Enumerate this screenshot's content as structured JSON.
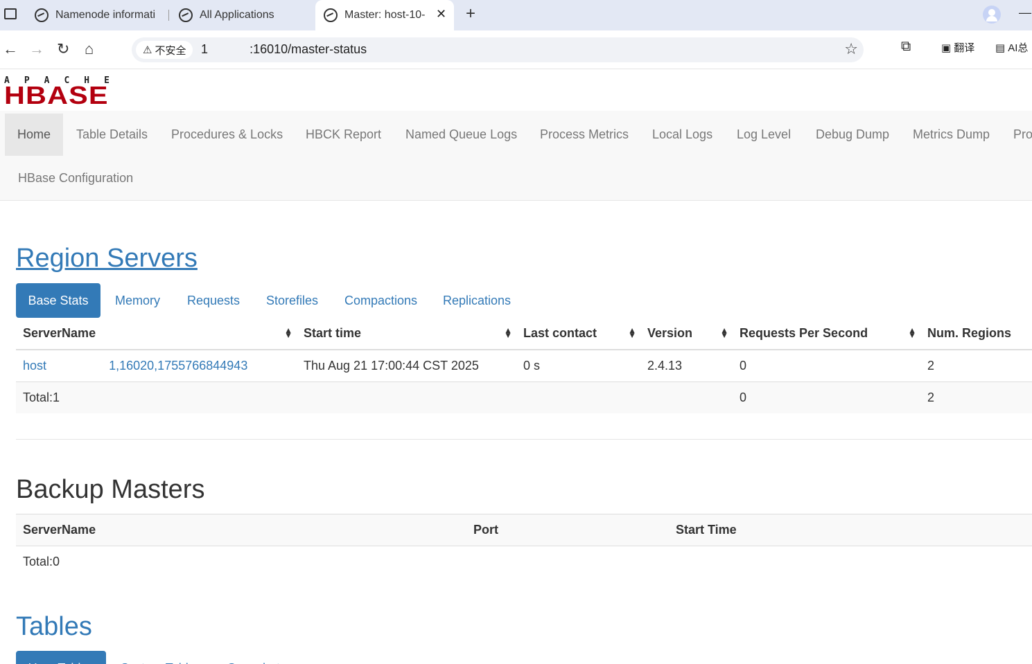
{
  "browser": {
    "tabs": [
      {
        "title": "Namenode informati"
      },
      {
        "title": "All Applications"
      },
      {
        "title": "Master: host-10-"
      }
    ],
    "security_label": "不安全",
    "url": "1      :16010/master-status",
    "translate_label": "翻译",
    "ai_label": "AI总"
  },
  "nav": {
    "items": [
      "Home",
      "Table Details",
      "Procedures & Locks",
      "HBCK Report",
      "Named Queue Logs",
      "Process Metrics",
      "Local Logs",
      "Log Level",
      "Debug Dump",
      "Metrics Dump",
      "Pro"
    ],
    "config": "HBase Configuration"
  },
  "logo": {
    "top": "APACHE",
    "bottom": "HBASE"
  },
  "region_servers": {
    "title": "Region Servers",
    "tabs": [
      "Base Stats",
      "Memory",
      "Requests",
      "Storefiles",
      "Compactions",
      "Replications"
    ],
    "columns": [
      "ServerName",
      "Start time",
      "Last contact",
      "Version",
      "Requests Per Second",
      "Num. Regions"
    ],
    "rows": [
      {
        "server": "host         1,16020,1755766844943",
        "start": "Thu Aug 21 17:00:44 CST 2025",
        "contact": "0 s",
        "version": "2.4.13",
        "rps": "0",
        "regions": "2"
      }
    ],
    "total": {
      "label": "Total:1",
      "rps": "0",
      "regions": "2"
    }
  },
  "backup_masters": {
    "title": "Backup Masters",
    "columns": [
      "ServerName",
      "Port",
      "Start Time"
    ],
    "total": "Total:0"
  },
  "tables": {
    "title": "Tables",
    "tabs": [
      "User Tables",
      "System Tables",
      "Snapshots"
    ]
  }
}
